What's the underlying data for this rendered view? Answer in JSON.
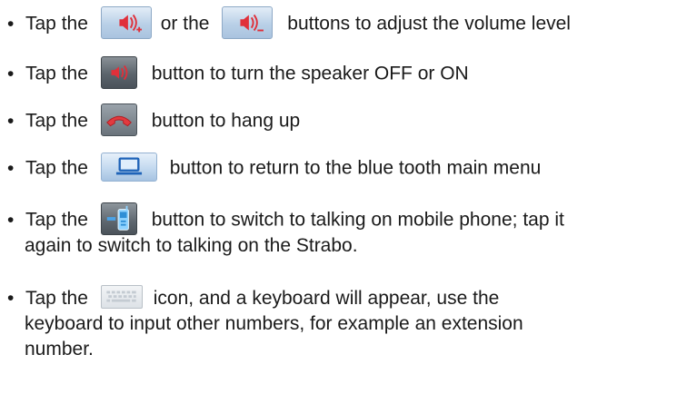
{
  "items": [
    {
      "bullet": "•",
      "pre": "Tap the",
      "mid": "or the",
      "post": "buttons to adjust the volume level",
      "icons": [
        "volume-up-icon",
        "volume-down-icon"
      ]
    },
    {
      "bullet": "•",
      "pre": "Tap the",
      "post": "button to turn the speaker OFF or ON",
      "icons": [
        "speaker-toggle-icon"
      ]
    },
    {
      "bullet": "•",
      "pre": "Tap the",
      "post": "button to hang up",
      "icons": [
        "hang-up-icon"
      ]
    },
    {
      "bullet": "•",
      "pre": "Tap the",
      "post": "button to return to the blue tooth main menu",
      "icons": [
        "bluetooth-main-menu-icon"
      ]
    },
    {
      "bullet": "•",
      "pre": "Tap the",
      "post": "button to switch to talking on mobile phone; tap it",
      "cont": [
        "again to switch to talking on the Strabo."
      ],
      "icons": [
        "mobile-phone-icon"
      ]
    },
    {
      "bullet": "•",
      "pre": "Tap the",
      "post": "icon, and a keyboard will appear, use the",
      "cont": [
        "keyboard to input other numbers, for example an extension",
        "number."
      ],
      "icons": [
        "keyboard-icon"
      ]
    }
  ]
}
